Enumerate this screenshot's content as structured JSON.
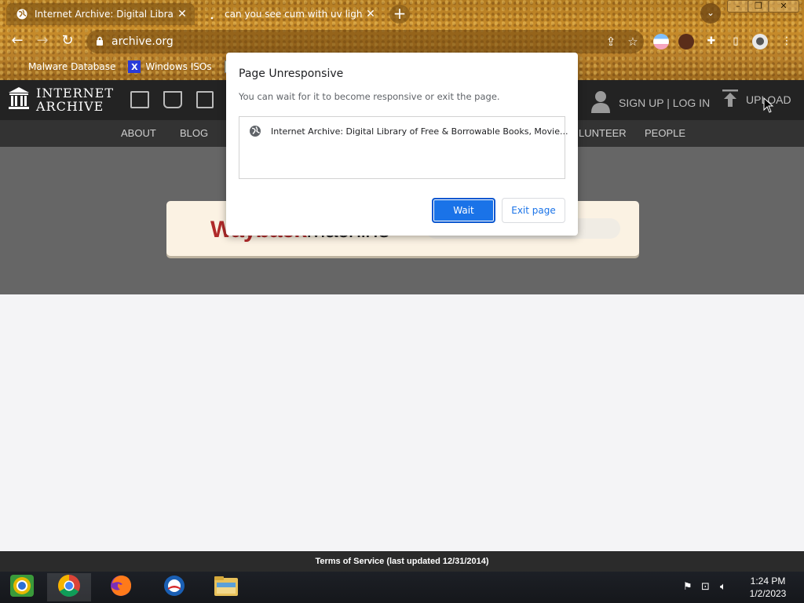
{
  "browser": {
    "tabs": [
      {
        "title": "Internet Archive: Digital Library",
        "active": true
      },
      {
        "title": "can you see cum with uv light - Go",
        "active": false
      }
    ],
    "new_tab_label": "+",
    "url": "archive.org",
    "bookmarks": [
      {
        "label": "Malware Database"
      },
      {
        "label": "Windows ISOs"
      }
    ],
    "theme_color": "#b27b22"
  },
  "ia": {
    "logo_line1": "INTERNET",
    "logo_line2": "ARCHIVE",
    "signin": "SIGN UP | LOG IN",
    "upload": "UPLOAD",
    "nav": [
      "ABOUT",
      "BLOG",
      "LUNTEER",
      "PEOPLE"
    ],
    "wayback_part1": "Wayback",
    "wayback_part2": "Machine",
    "footer": "Terms of Service (last updated 12/31/2014)"
  },
  "dialog": {
    "title": "Page Unresponsive",
    "message": "You can wait for it to become responsive or exit the page.",
    "page_item": "Internet Archive: Digital Library of Free & Borrowable Books, Movie...",
    "wait_label": "Wait",
    "exit_label": "Exit page",
    "primary_color": "#1a73e8"
  },
  "taskbar": {
    "time": "1:24 PM",
    "date": "1/2/2023"
  }
}
